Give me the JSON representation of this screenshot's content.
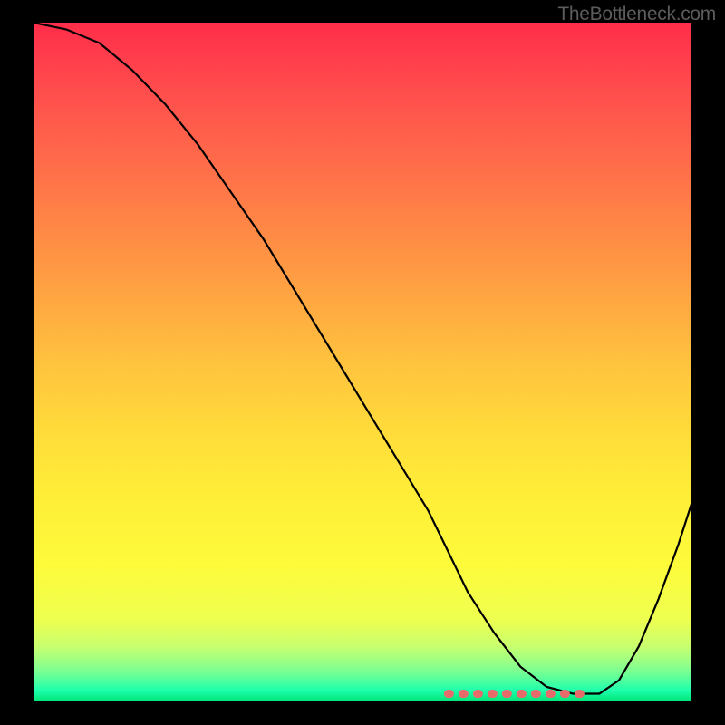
{
  "watermark": "TheBottleneck.com",
  "chart_data": {
    "type": "line",
    "title": "",
    "xlabel": "",
    "ylabel": "",
    "xlim": [
      0,
      100
    ],
    "ylim": [
      0,
      100
    ],
    "series": [
      {
        "name": "bottleneck-curve",
        "x": [
          0,
          5,
          10,
          15,
          20,
          25,
          30,
          35,
          40,
          45,
          50,
          55,
          60,
          63,
          66,
          70,
          74,
          78,
          82,
          84,
          86,
          89,
          92,
          95,
          98,
          100
        ],
        "y": [
          100,
          99,
          97,
          93,
          88,
          82,
          75,
          68,
          60,
          52,
          44,
          36,
          28,
          22,
          16,
          10,
          5,
          2,
          1,
          1,
          1,
          3,
          8,
          15,
          23,
          29
        ]
      }
    ],
    "flat_region": {
      "x_start": 63,
      "x_end": 84,
      "y": 1,
      "color": "#e86b6b"
    },
    "gradient_stops": [
      {
        "pos": 0,
        "color": "#ff2d4a"
      },
      {
        "pos": 0.5,
        "color": "#ffc23e"
      },
      {
        "pos": 0.85,
        "color": "#fdfb3a"
      },
      {
        "pos": 1.0,
        "color": "#00e67a"
      }
    ]
  }
}
